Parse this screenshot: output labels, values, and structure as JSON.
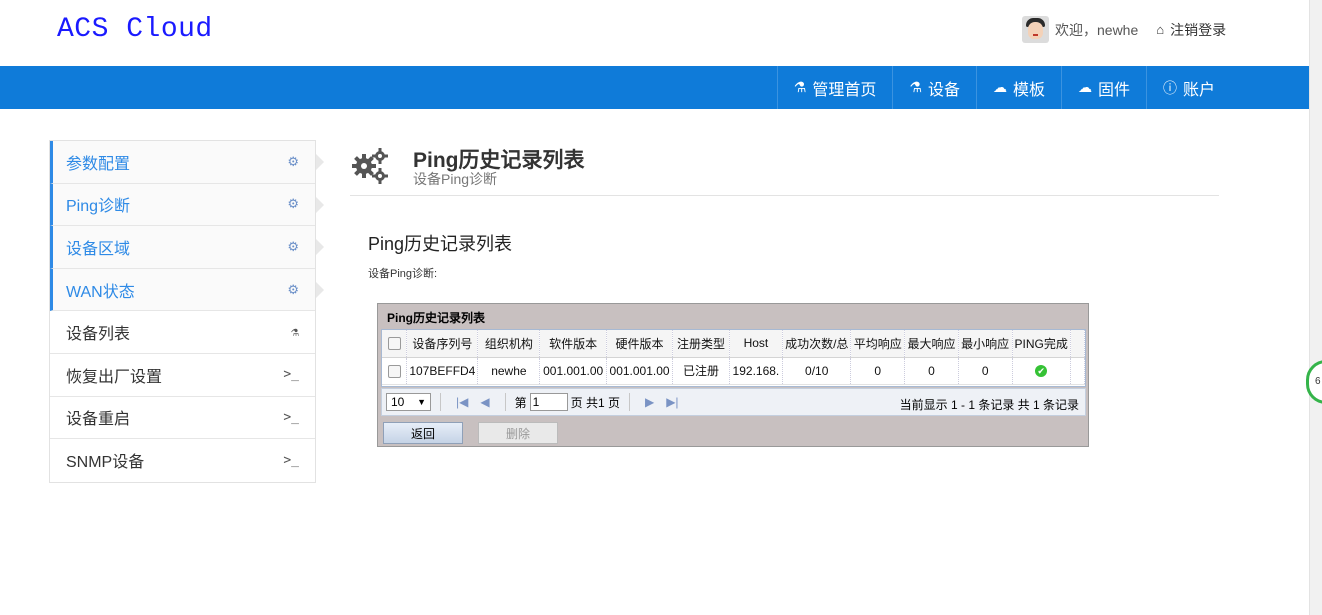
{
  "app": {
    "logo": "ACS Cloud"
  },
  "user": {
    "welcome": "欢迎，newhe",
    "logout": "注销登录"
  },
  "nav": {
    "items": [
      {
        "label": "管理首页",
        "icon": "sitemap-icon"
      },
      {
        "label": "设备",
        "icon": "sitemap-icon"
      },
      {
        "label": "模板",
        "icon": "cloud-icon"
      },
      {
        "label": "固件",
        "icon": "cloud-icon"
      },
      {
        "label": "账户",
        "icon": "info-icon"
      }
    ]
  },
  "sidebar": {
    "items": [
      {
        "label": "参数配置",
        "active": true,
        "icon": "gears-icon"
      },
      {
        "label": "Ping诊断",
        "active": true,
        "icon": "gears-icon"
      },
      {
        "label": "设备区域",
        "active": true,
        "icon": "gears-icon"
      },
      {
        "label": "WAN状态",
        "active": true,
        "icon": "gears-icon"
      },
      {
        "label": "设备列表",
        "active": false,
        "icon": "sitemap-icon"
      },
      {
        "label": "恢复出厂设置",
        "active": false,
        "icon": "terminal-icon"
      },
      {
        "label": "设备重启",
        "active": false,
        "icon": "terminal-icon"
      },
      {
        "label": "SNMP设备",
        "active": false,
        "icon": "terminal-icon"
      }
    ]
  },
  "page": {
    "title": "Ping历史记录列表",
    "subtitle": "设备Ping诊断"
  },
  "section": {
    "title": "Ping历史记录列表",
    "desc": "设备Ping诊断:"
  },
  "grid": {
    "title": "Ping历史记录列表",
    "columns": [
      "设备序列号",
      "组织机构",
      "软件版本",
      "硬件版本",
      "注册类型",
      "Host",
      "成功次数/总",
      "平均响应",
      "最大响应",
      "最小响应",
      "PING完成"
    ],
    "rows": [
      [
        "107BEFFD4",
        "newhe",
        "001.001.00",
        "001.001.00",
        "已注册",
        "192.168.",
        "0/10",
        "0",
        "0",
        "0",
        "✔"
      ]
    ],
    "pager": {
      "page_size": "10",
      "page_prefix": "第",
      "page_value": "1",
      "page_suffix": "页 共1 页",
      "info": "当前显示 1 - 1 条记录 共 1 条记录"
    },
    "buttons": {
      "back": "返回",
      "delete": "删除"
    }
  },
  "float_badge": "6"
}
